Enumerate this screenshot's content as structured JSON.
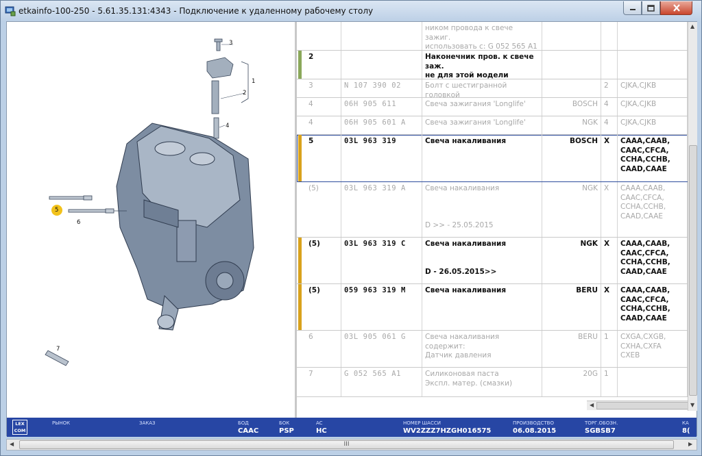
{
  "window": {
    "title": "etkainfo-100-250 - 5.61.35.131:4343 - Подключение к удаленному рабочему столу",
    "minimize_icon": "minimize-icon",
    "maximize_icon": "maximize-icon",
    "close_icon": "close-icon"
  },
  "diagram": {
    "callouts": [
      "3",
      "1",
      "2",
      "4",
      "5",
      "6",
      "7"
    ],
    "highlighted_callout": "5",
    "highlight_color": "#f2c21b"
  },
  "parts_table": {
    "rows": [
      {
        "pos": "",
        "part": "",
        "desc": "ником провода к свече зажиг.\nиспользовать с:  G  052 565 A1",
        "supplier": "",
        "qty": "",
        "models": "",
        "style": "gray",
        "marker": ""
      },
      {
        "pos": "2",
        "part": "",
        "desc": "Наконечник пров. к свече заж.\nне для этой модели",
        "supplier": "",
        "qty": "",
        "models": "",
        "style": "active",
        "marker": "#8aa85a"
      },
      {
        "pos": "3",
        "part": "N    107  390  02",
        "desc": "Болт с шестигранной головкой",
        "supplier": "",
        "qty": "2",
        "models": "CJKA,CJKB",
        "style": "gray",
        "marker": ""
      },
      {
        "pos": "4",
        "part": "06H  905  611",
        "desc": "Свеча зажигания 'Longlife'",
        "supplier": "BOSCH",
        "qty": "4",
        "models": "CJKA,CJKB",
        "style": "gray",
        "marker": ""
      },
      {
        "pos": "4",
        "part": "06H  905  601  A",
        "desc": "Свеча зажигания 'Longlife'",
        "supplier": "NGK",
        "qty": "4",
        "models": "CJKA,CJKB",
        "style": "gray",
        "marker": ""
      },
      {
        "pos": "5",
        "part": "03L  963  319",
        "desc": "Свеча накаливания",
        "supplier": "BOSCH",
        "qty": "X",
        "models": "CAAA,CAAB,\nCAAC,CFCA,\nCCHA,CCHB,\nCAAD,CAAE",
        "style": "active selected",
        "marker": "#d9a21c"
      },
      {
        "pos": "(5)",
        "part": "03L  963  319  A",
        "desc": "Свеча накаливания\n\n\n\nD          >> - 25.05.2015",
        "supplier": "NGK",
        "qty": "X",
        "models": "CAAA,CAAB,\nCAAC,CFCA,\nCCHA,CCHB,\nCAAD,CAAE",
        "style": "gray",
        "marker": ""
      },
      {
        "pos": "(5)",
        "part": "03L  963  319  C",
        "desc": "Свеча накаливания\n\n\nD - 26.05.2015>>",
        "supplier": "NGK",
        "qty": "X",
        "models": "CAAA,CAAB,\nCAAC,CFCA,\nCCHA,CCHB,\nCAAD,CAAE",
        "style": "active",
        "marker": "#d9a21c"
      },
      {
        "pos": "(5)",
        "part": "059  963  319  M",
        "desc": "Свеча накаливания",
        "supplier": "BERU",
        "qty": "X",
        "models": "CAAA,CAAB,\nCAAC,CFCA,\nCCHA,CCHB,\nCAAD,CAAE",
        "style": "active",
        "marker": "#d9a21c"
      },
      {
        "pos": "6",
        "part": "03L  905  061  G",
        "desc": "Свеча накаливания\nсодержит:\nДатчик давления",
        "supplier": "BERU",
        "qty": "1",
        "models": "CXGA,CXGB,\nCXHA,CXFA\nCXEB",
        "style": "gray",
        "marker": ""
      },
      {
        "pos": "7",
        "part": "G    052  565  A1",
        "desc": "Силиконовая паста\nЭкспл. матер. (смазки)",
        "supplier": "20G",
        "qty": "1",
        "models": "",
        "style": "gray",
        "marker": ""
      }
    ]
  },
  "statusbar": {
    "logo": "LEX\nCOM",
    "fields": [
      {
        "label": "РЫНОК",
        "value": ""
      },
      {
        "label": "ЗАКАЗ",
        "value": ""
      },
      {
        "label": "БОД",
        "value": "CAAC"
      },
      {
        "label": "БОК",
        "value": "PSP"
      },
      {
        "label": "AC",
        "value": "HC"
      },
      {
        "label": "НОМЕР ШАССИ",
        "value": "WV2ZZZ7HZGH016575"
      },
      {
        "label": "ПРОИЗВОДСТВО",
        "value": "06.08.2015"
      },
      {
        "label": "ТОРГ.ОБОЗН.",
        "value": "SGBSB7"
      },
      {
        "label": "КА",
        "value": "8("
      }
    ]
  },
  "scrollbar": {
    "grip": "III"
  }
}
